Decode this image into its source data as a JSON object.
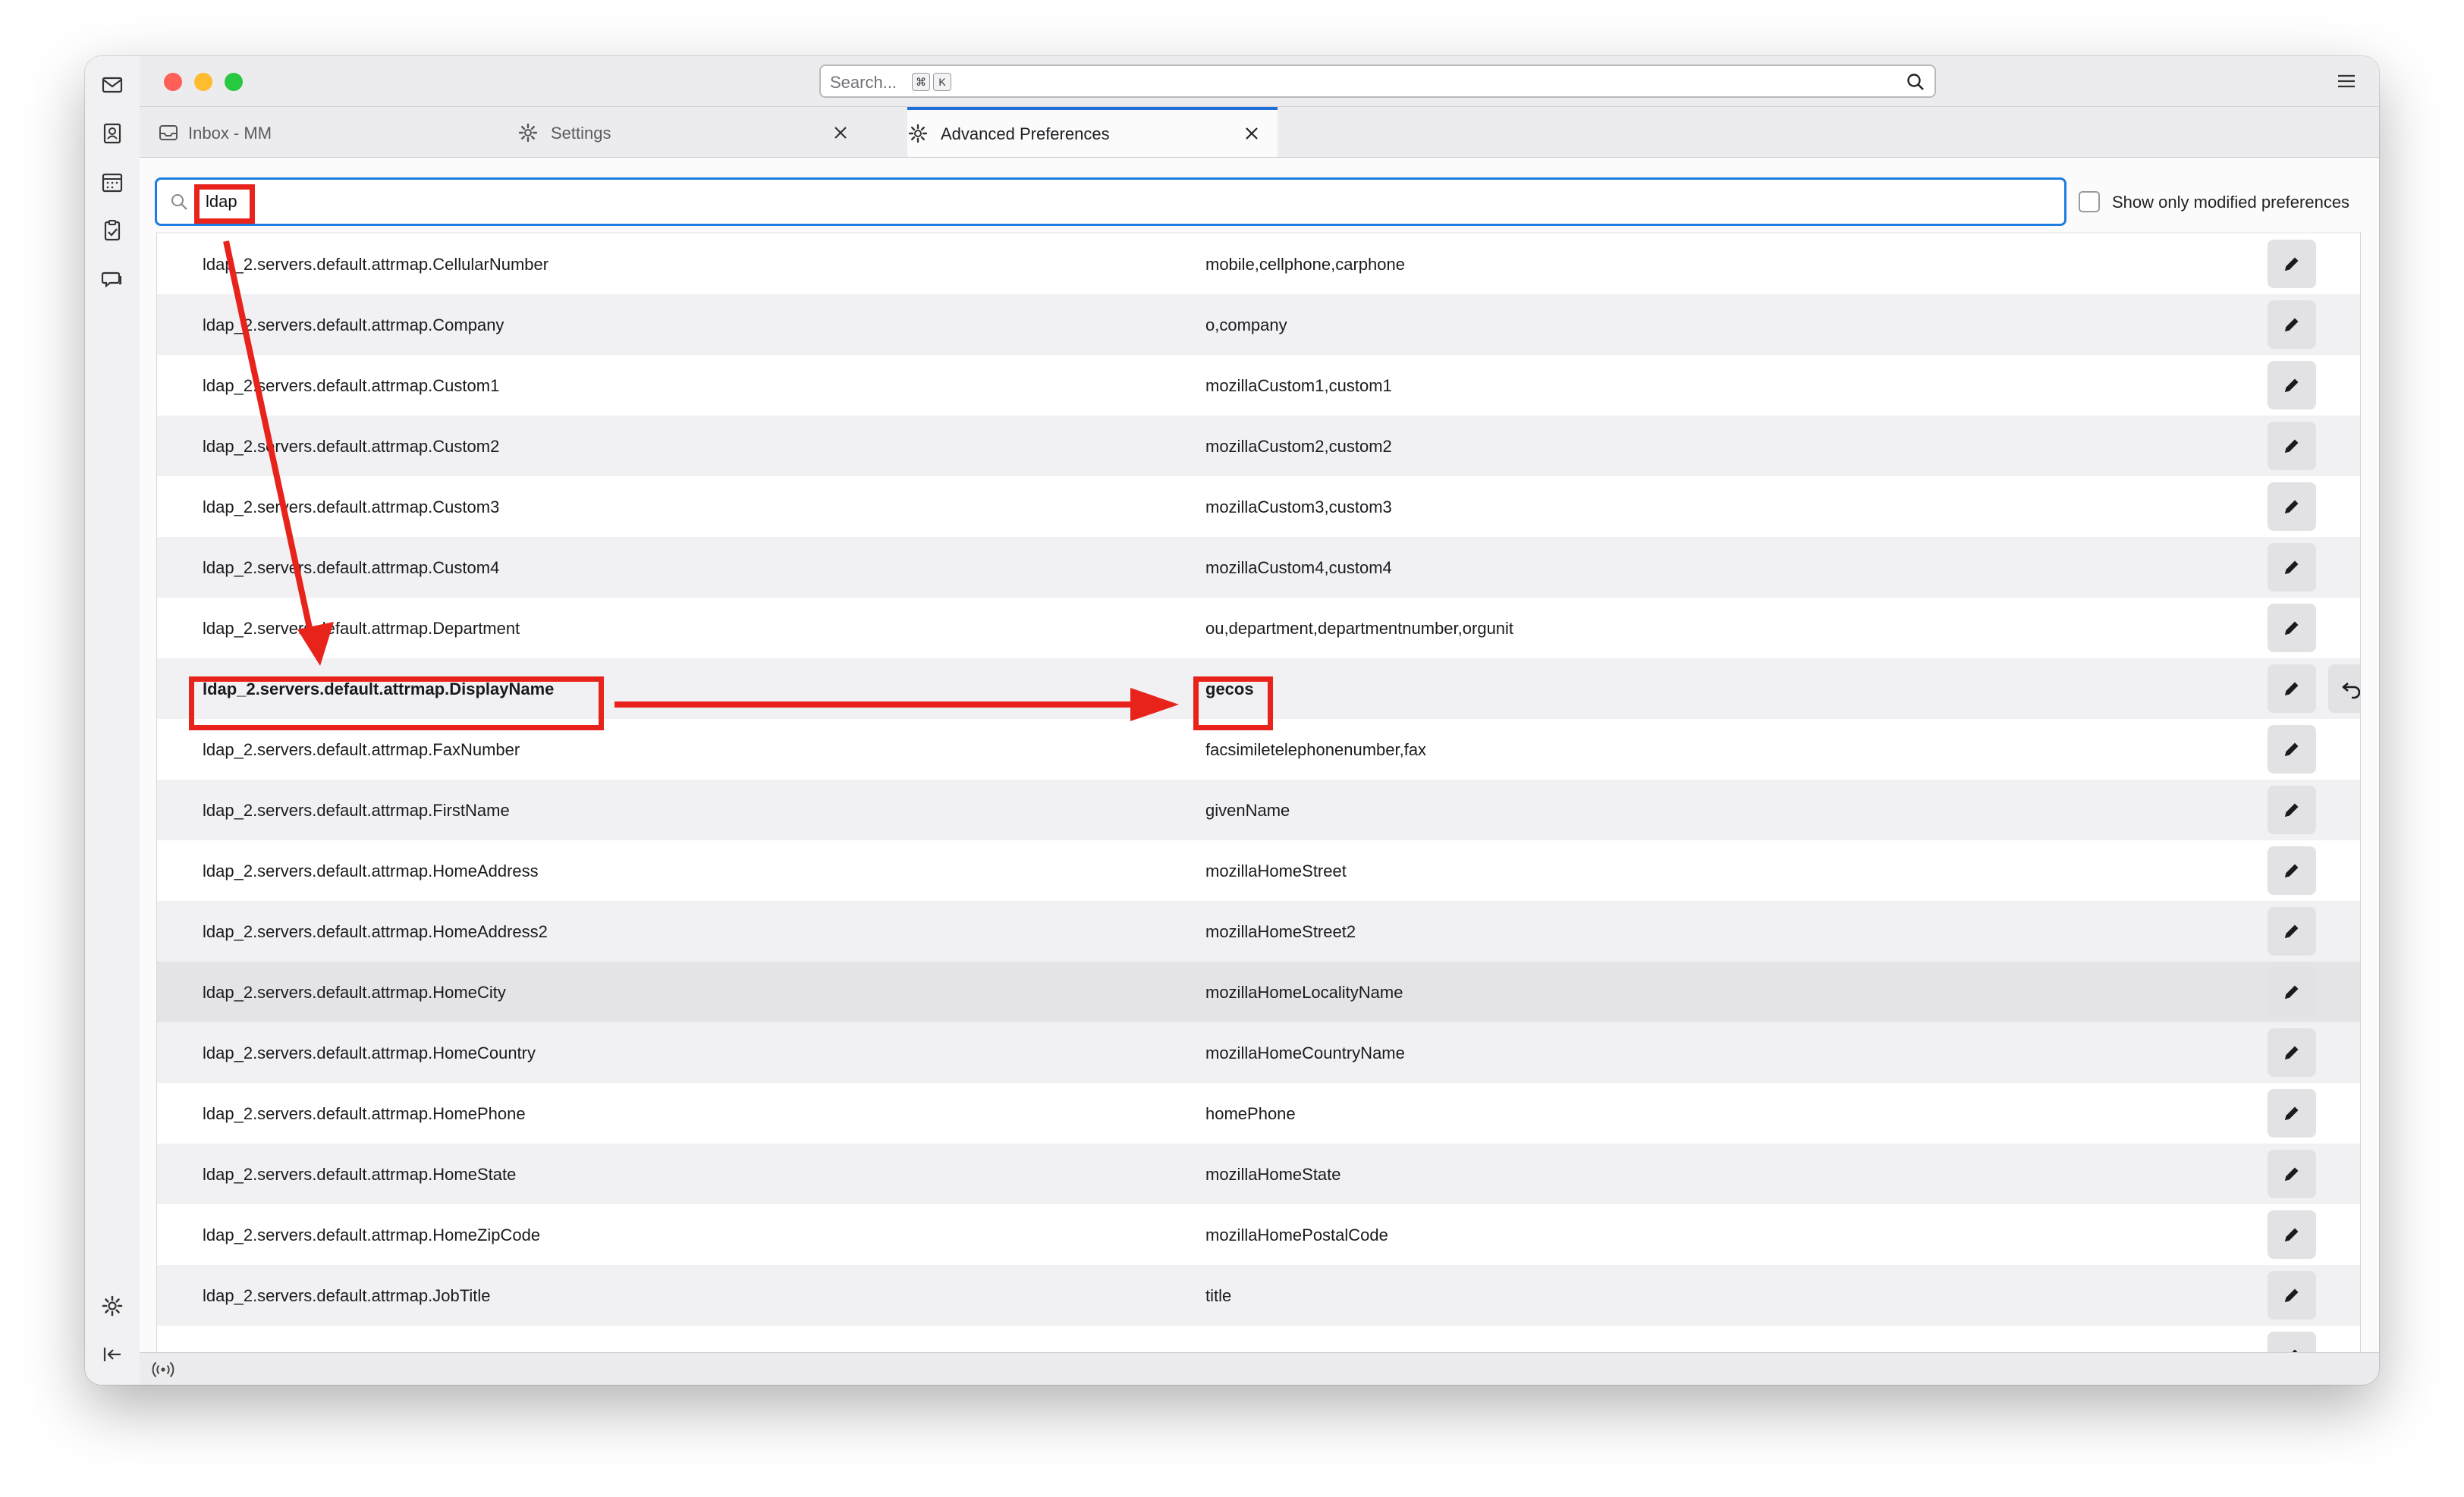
{
  "titlebar": {
    "search_placeholder": "Search...",
    "kbd_cmd": "⌘",
    "kbd_k": "K"
  },
  "tabs": [
    {
      "label": "Inbox - MM",
      "icon": "inbox-icon"
    },
    {
      "label": "Settings",
      "icon": "gear-icon"
    },
    {
      "label": "Advanced Preferences",
      "icon": "gear-icon",
      "active": true
    }
  ],
  "filter": {
    "value": "ldap",
    "checkbox_label": "Show only modified preferences",
    "checkbox_checked": false
  },
  "prefs": [
    {
      "name": "ldap_2.servers.default.attrmap.CellularNumber",
      "value": "mobile,cellphone,carphone"
    },
    {
      "name": "ldap_2.servers.default.attrmap.Company",
      "value": "o,company"
    },
    {
      "name": "ldap_2.servers.default.attrmap.Custom1",
      "value": "mozillaCustom1,custom1"
    },
    {
      "name": "ldap_2.servers.default.attrmap.Custom2",
      "value": "mozillaCustom2,custom2"
    },
    {
      "name": "ldap_2.servers.default.attrmap.Custom3",
      "value": "mozillaCustom3,custom3"
    },
    {
      "name": "ldap_2.servers.default.attrmap.Custom4",
      "value": "mozillaCustom4,custom4"
    },
    {
      "name": "ldap_2.servers.default.attrmap.Department",
      "value": "ou,department,departmentnumber,orgunit"
    },
    {
      "name": "ldap_2.servers.default.attrmap.DisplayName",
      "value": "gecos",
      "modified": true
    },
    {
      "name": "ldap_2.servers.default.attrmap.FaxNumber",
      "value": "facsimiletelephonenumber,fax"
    },
    {
      "name": "ldap_2.servers.default.attrmap.FirstName",
      "value": "givenName"
    },
    {
      "name": "ldap_2.servers.default.attrmap.HomeAddress",
      "value": "mozillaHomeStreet"
    },
    {
      "name": "ldap_2.servers.default.attrmap.HomeAddress2",
      "value": "mozillaHomeStreet2"
    },
    {
      "name": "ldap_2.servers.default.attrmap.HomeCity",
      "value": "mozillaHomeLocalityName",
      "hover": true
    },
    {
      "name": "ldap_2.servers.default.attrmap.HomeCountry",
      "value": "mozillaHomeCountryName"
    },
    {
      "name": "ldap_2.servers.default.attrmap.HomePhone",
      "value": "homePhone"
    },
    {
      "name": "ldap_2.servers.default.attrmap.HomeState",
      "value": "mozillaHomeState"
    },
    {
      "name": "ldap_2.servers.default.attrmap.HomeZipCode",
      "value": "mozillaHomePostalCode"
    },
    {
      "name": "ldap_2.servers.default.attrmap.JobTitle",
      "value": "title"
    }
  ],
  "icons": {
    "edit": "pencil-icon",
    "reset": "undo-icon",
    "status": "wifi-signal-icon"
  },
  "colors": {
    "accent": "#1e6fd9",
    "annotation": "#e8231c"
  }
}
